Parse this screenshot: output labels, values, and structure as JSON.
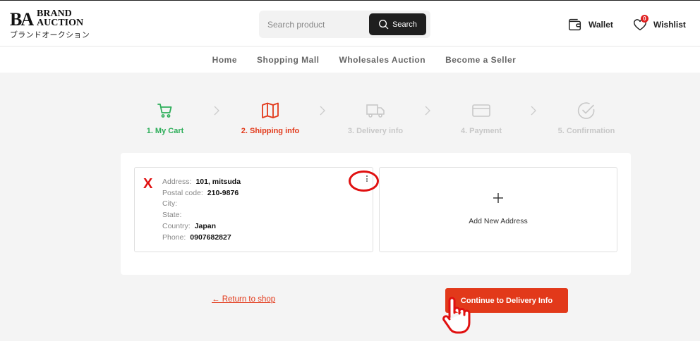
{
  "header": {
    "logo": {
      "mark": "BA",
      "brand_line1": "BRAND",
      "brand_line2": "AUCTION",
      "japanese": "ブランドオークション"
    },
    "search": {
      "placeholder": "Search product",
      "button_label": "Search"
    },
    "wallet_label": "Wallet",
    "wishlist_label": "Wishlist",
    "wishlist_count": "0"
  },
  "nav": {
    "items": [
      {
        "label": "Home"
      },
      {
        "label": "Shopping Mall"
      },
      {
        "label": "Wholesales Auction"
      },
      {
        "label": "Become a Seller"
      }
    ]
  },
  "stepper": {
    "steps": [
      {
        "label": "1. My Cart",
        "icon": "cart-icon",
        "state": "done",
        "color": "#2eae5a"
      },
      {
        "label": "2. Shipping info",
        "icon": "map-icon",
        "state": "active",
        "color": "#e2391a"
      },
      {
        "label": "3. Delivery info",
        "icon": "truck-icon",
        "state": "pending",
        "color": "#c8c8c8"
      },
      {
        "label": "4. Payment",
        "icon": "card-icon",
        "state": "pending",
        "color": "#c8c8c8"
      },
      {
        "label": "5. Confirmation",
        "icon": "check-circle-icon",
        "state": "pending",
        "color": "#c8c8c8"
      }
    ]
  },
  "address": {
    "marker": "X",
    "rows": [
      {
        "label": "Address:",
        "value": "101, mitsuda"
      },
      {
        "label": "Postal code:",
        "value": "210-9876"
      },
      {
        "label": "City:",
        "value": ""
      },
      {
        "label": "State:",
        "value": ""
      },
      {
        "label": "Country:",
        "value": "Japan"
      },
      {
        "label": "Phone:",
        "value": "0907682827"
      }
    ]
  },
  "add_address_label": "Add New Address",
  "actions": {
    "return_label": "← Return to shop",
    "continue_label": "Continue to Delivery Info"
  },
  "colors": {
    "accent": "#e2391a",
    "success": "#2eae5a",
    "inactive": "#c8c8c8",
    "annotation": "#e01010"
  }
}
